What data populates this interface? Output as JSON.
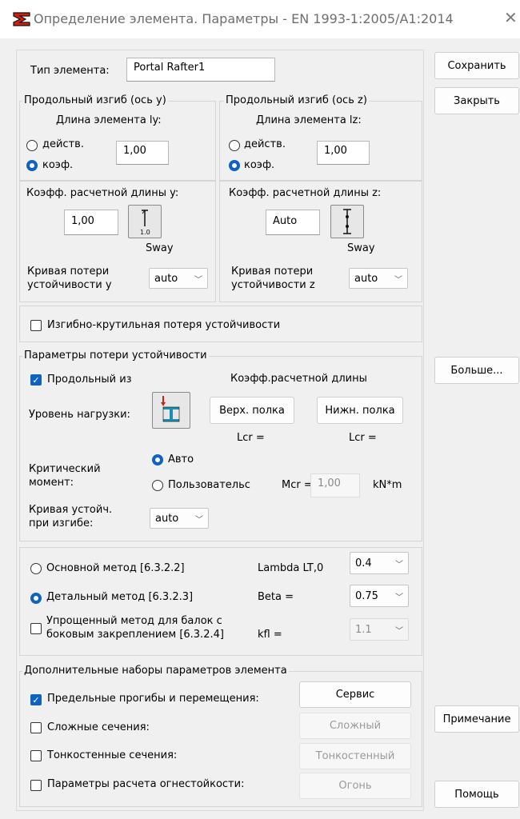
{
  "window": {
    "title": "Определение элемента. Параметры - EN 1993-1:2005/A1:2014"
  },
  "element_type": {
    "label": "Тип элемента:",
    "value": "Portal Rafter1"
  },
  "buckling_y": {
    "group": "Продольный изгиб (ось y)",
    "length_label": "Длина элемента ly:",
    "opt_actual": "действ.",
    "opt_coef": "коэф.",
    "value": "1,00",
    "coef_label": "Коэфф. расчетной длины y:",
    "coef_value": "1,00",
    "icon_text": "1.0",
    "sway": "Sway",
    "curve_label_1": "Кривая потери",
    "curve_label_2": "устойчивости  y",
    "curve_value": "auto"
  },
  "buckling_z": {
    "group": "Продольный изгиб (ось z)",
    "length_label": "Длина элемента lz:",
    "opt_actual": "действ.",
    "opt_coef": "коэф.",
    "value": "1,00",
    "coef_label": "Коэфф. расчетной длины z:",
    "coef_value": "Auto",
    "sway": "Sway",
    "curve_label_1": "Кривая потери",
    "curve_label_2": "устойчивости  z",
    "curve_value": "auto"
  },
  "torsional": {
    "label": "Изгибно-крутильная потеря устойчивости"
  },
  "ltb": {
    "group": "Параметры потери устойчивости",
    "chk_label": "Продольный из",
    "coef_label": "Коэфф.расчетной длины",
    "load_level": "Уровень нагрузки:",
    "top_flange": "Верх. полка",
    "bottom_flange": "Нижн. полка",
    "lcr1": "Lcr =",
    "lcr2": "Lcr =",
    "crit_label_1": "Критический",
    "crit_label_2": "момент:",
    "opt_auto": "Авто",
    "opt_user": "Пользовательс",
    "mcr_label": "Mcr =",
    "mcr_value": "1,00",
    "mcr_unit": "kN*m",
    "curve_label_1": "Кривая устойч.",
    "curve_label_2": "при изгибе:",
    "curve_value": "auto"
  },
  "methods": {
    "basic": "Основной метод  [6.3.2.2]",
    "detailed": "Детальный метод   [6.3.2.3]",
    "simplified_1": "Упрощенный метод для балок с",
    "simplified_2": "боковым закреплением [6.3.2.4]",
    "lambda_label": "Lambda LT,0",
    "lambda_value": "0.4",
    "beta_label": "Beta =",
    "beta_value": "0.75",
    "kfl_label": "kfl =",
    "kfl_value": "1.1"
  },
  "extra": {
    "group": "Дополнительные наборы параметров элемента",
    "deflections": "Предельные прогибы и перемещения:",
    "complex": "Сложные сечения:",
    "thin": "Тонкостенные сечения:",
    "fire": "Параметры расчета огнестойкости:",
    "btn_service": "Сервис",
    "btn_complex": "Сложный",
    "btn_thin": "Тонкостенный",
    "btn_fire": "Огонь"
  },
  "side_buttons": {
    "save": "Сохранить",
    "close": "Закрыть",
    "more": "Больше...",
    "note": "Примечание",
    "help": "Помощь"
  },
  "colors": {
    "accent": "#0f62c0",
    "icon_red": "#d02010"
  }
}
